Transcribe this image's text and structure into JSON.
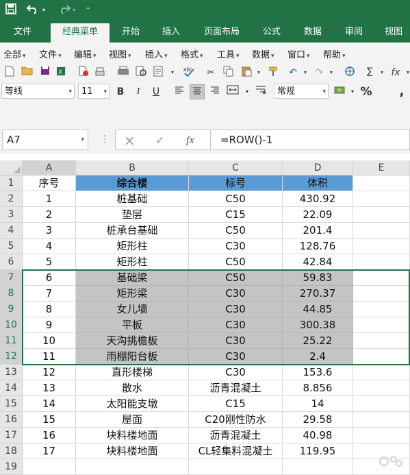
{
  "qat": {
    "save_icon": "save-icon",
    "undo_icon": "undo-icon",
    "redo_icon": "redo-icon",
    "customize_icon": "customize-qat-icon"
  },
  "ribbon_tabs": [
    "文件",
    "经典菜单",
    "开始",
    "插入",
    "页面布局",
    "公式",
    "数据",
    "审阅",
    "视图"
  ],
  "active_tab": "经典菜单",
  "menu_items": [
    "全部",
    "文件",
    "编辑",
    "视图",
    "插入",
    "格式",
    "工具",
    "数据",
    "窗口",
    "帮助"
  ],
  "toolbar": {
    "font_name": "等线",
    "font_size": "11",
    "bold": "B",
    "italic": "I",
    "underline": "U",
    "number_format": "常规",
    "percent": "%",
    "comma": ","
  },
  "formula_bar": {
    "name_box": "A7",
    "cancel": "×",
    "enter": "✓",
    "fx": "fx",
    "formula": "=ROW()-1"
  },
  "columns": [
    "A",
    "B",
    "C",
    "D",
    "E"
  ],
  "rows": [
    {
      "n": "1",
      "a": "序号",
      "b": "综合楼",
      "c": "标号",
      "d": "体积"
    },
    {
      "n": "2",
      "a": "1",
      "b": "桩基础",
      "c": "C50",
      "d": "430.92"
    },
    {
      "n": "3",
      "a": "2",
      "b": "垫层",
      "c": "C15",
      "d": "22.09"
    },
    {
      "n": "4",
      "a": "3",
      "b": "桩承台基础",
      "c": "C50",
      "d": "201.4"
    },
    {
      "n": "5",
      "a": "4",
      "b": "矩形柱",
      "c": "C30",
      "d": "128.76"
    },
    {
      "n": "6",
      "a": "5",
      "b": "矩形柱",
      "c": "C50",
      "d": "42.84"
    },
    {
      "n": "7",
      "a": "6",
      "b": "基础梁",
      "c": "C50",
      "d": "59.83"
    },
    {
      "n": "8",
      "a": "7",
      "b": "矩形梁",
      "c": "C30",
      "d": "270.37"
    },
    {
      "n": "9",
      "a": "8",
      "b": "女儿墙",
      "c": "C30",
      "d": "44.85"
    },
    {
      "n": "10",
      "a": "9",
      "b": "平板",
      "c": "C30",
      "d": "300.38"
    },
    {
      "n": "11",
      "a": "10",
      "b": "天沟挑檐板",
      "c": "C30",
      "d": "25.22"
    },
    {
      "n": "12",
      "a": "11",
      "b": "雨棚阳台板",
      "c": "C30",
      "d": "2.4"
    },
    {
      "n": "13",
      "a": "12",
      "b": "直形楼梯",
      "c": "C30",
      "d": "153.6"
    },
    {
      "n": "14",
      "a": "13",
      "b": "散水",
      "c": "沥青混凝土",
      "d": "8.856"
    },
    {
      "n": "15",
      "a": "14",
      "b": "太阳能支墩",
      "c": "C15",
      "d": "14"
    },
    {
      "n": "16",
      "a": "15",
      "b": "屋面",
      "c": "C20刚性防水",
      "d": "29.58"
    },
    {
      "n": "17",
      "a": "16",
      "b": "块料楼地面",
      "c": "沥青混凝土",
      "d": "40.98"
    },
    {
      "n": "18",
      "a": "17",
      "b": "块料楼地面",
      "c": "CL轻集料混凝土",
      "d": "119.95"
    },
    {
      "n": "19",
      "a": "",
      "b": "",
      "c": "",
      "d": ""
    }
  ],
  "colors": {
    "accent": "#217346",
    "header_fill": "#5b9bd5",
    "selection_fill": "#c4c4c4"
  }
}
